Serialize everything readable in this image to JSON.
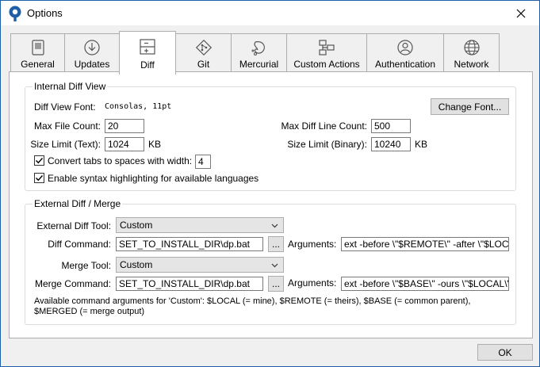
{
  "window": {
    "title": "Options"
  },
  "tabs": [
    {
      "label": "General"
    },
    {
      "label": "Updates"
    },
    {
      "label": "Diff"
    },
    {
      "label": "Git"
    },
    {
      "label": "Mercurial"
    },
    {
      "label": "Custom Actions"
    },
    {
      "label": "Authentication"
    },
    {
      "label": "Network"
    }
  ],
  "active_tab": "Diff",
  "internal_diff": {
    "title": "Internal Diff View",
    "font_label": "Diff View Font:",
    "font_value": "Consolas, 11pt",
    "change_font_label": "Change Font...",
    "max_file_count_label": "Max File Count:",
    "max_file_count": "20",
    "max_diff_line_label": "Max Diff Line Count:",
    "max_diff_line": "500",
    "size_text_label": "Size Limit (Text):",
    "size_text": "1024",
    "size_text_unit": "KB",
    "size_binary_label": "Size Limit (Binary):",
    "size_binary": "10240",
    "size_binary_unit": "KB",
    "tabs_label": "Convert tabs to spaces with width:",
    "tabs_checked": true,
    "tabs_width": "4",
    "syntax_label": "Enable syntax highlighting for available languages",
    "syntax_checked": true
  },
  "external_diff": {
    "title": "External Diff / Merge",
    "diff_tool_label": "External Diff Tool:",
    "diff_tool": "Custom",
    "diff_command_label": "Diff Command:",
    "diff_command": "SET_TO_INSTALL_DIR\\dp.bat",
    "browse_label": "...",
    "diff_args_label": "Arguments:",
    "diff_args": "ext -before \\\"$REMOTE\\\" -after \\\"$LOCAL\\\"",
    "merge_tool_label": "Merge Tool:",
    "merge_tool": "Custom",
    "merge_command_label": "Merge Command:",
    "merge_command": "SET_TO_INSTALL_DIR\\dp.bat",
    "merge_args_label": "Arguments:",
    "merge_args": "ext -before \\\"$BASE\\\" -ours \\\"$LOCAL\\\"",
    "note_line1": "Available command arguments for 'Custom': $LOCAL (= mine), $REMOTE (= theirs), $BASE (= common parent),",
    "note_line2": "$MERGED (= merge output)"
  },
  "footer": {
    "ok_label": "OK"
  }
}
